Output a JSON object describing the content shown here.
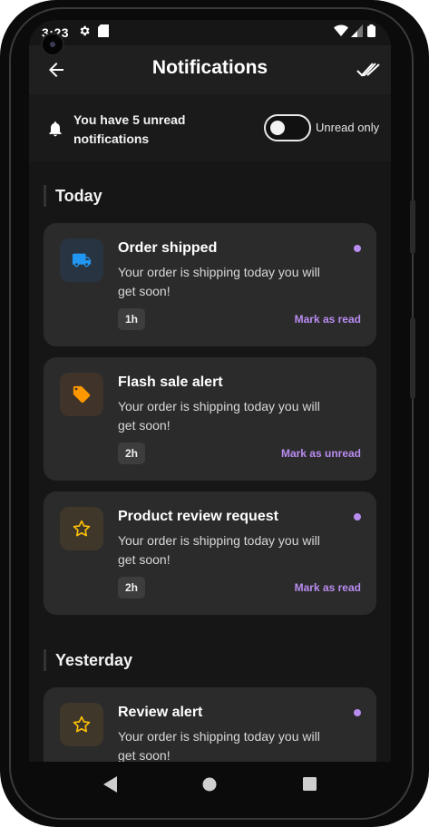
{
  "status_bar": {
    "time": "3:23",
    "icons": [
      "settings-icon",
      "sd-card-icon",
      "wifi-icon",
      "signal-icon",
      "battery-icon"
    ]
  },
  "app_bar": {
    "title": "Notifications",
    "back_icon": "arrow-back-icon",
    "action_icon": "done-all-icon"
  },
  "unread_banner": {
    "text": "You have 5 unread notifications",
    "toggle_label": "Unread only",
    "toggle_on": false
  },
  "sections": [
    {
      "label": "Today",
      "items": [
        {
          "title": "Order shipped",
          "body": "Your order is shipping today you will get soon!",
          "time": "1h",
          "action": "Mark as read",
          "unread": true,
          "icon": "truck-icon",
          "icon_color": "#2196f3",
          "tile_color": "#283441"
        },
        {
          "title": "Flash sale alert",
          "body": "Your order is shipping today you will get soon!",
          "time": "2h",
          "action": "Mark as unread",
          "unread": false,
          "icon": "tag-icon",
          "icon_color": "#ff9800",
          "tile_color": "#40342a"
        },
        {
          "title": "Product review request",
          "body": "Your order is shipping today you will get soon!",
          "time": "2h",
          "action": "Mark as read",
          "unread": true,
          "icon": "star-icon",
          "icon_color": "#ffc107",
          "tile_color": "#3f372a"
        }
      ]
    },
    {
      "label": "Yesterday",
      "items": [
        {
          "title": "Review alert",
          "body": "Your order is shipping today you will get soon!",
          "time": "",
          "action": "",
          "unread": true,
          "icon": "star-icon",
          "icon_color": "#ffc107",
          "tile_color": "#3f372a"
        }
      ]
    }
  ],
  "colors": {
    "accent": "#b98cf0",
    "background": "#161616",
    "card": "#2b2b2b"
  },
  "nav_bar": {
    "icons": [
      "nav-back-icon",
      "nav-home-icon",
      "nav-recents-icon"
    ]
  }
}
